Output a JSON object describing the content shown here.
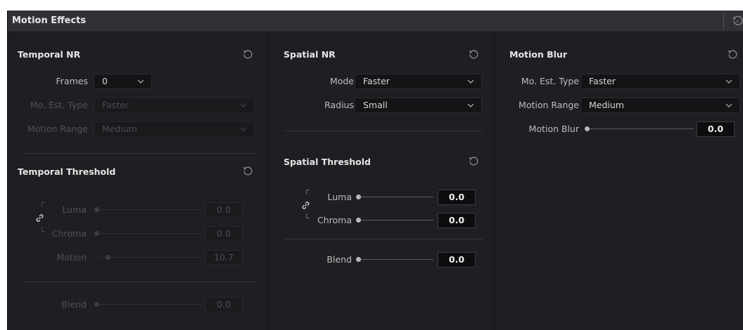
{
  "panel": {
    "title": "Motion Effects",
    "header_reset_icon": "reset-icon"
  },
  "temporal_nr": {
    "title": "Temporal NR",
    "frames_label": "Frames",
    "frames_value": "0",
    "mo_est_type_label": "Mo. Est. Type",
    "mo_est_type_value": "Faster",
    "motion_range_label": "Motion Range",
    "motion_range_value": "Medium",
    "threshold_title": "Temporal Threshold",
    "luma_label": "Luma",
    "luma_value": "0.0",
    "chroma_label": "Chroma",
    "chroma_value": "0.0",
    "motion_label": "Motion",
    "motion_value": "10.7",
    "blend_label": "Blend",
    "blend_value": "0.0"
  },
  "spatial_nr": {
    "title": "Spatial NR",
    "mode_label": "Mode",
    "mode_value": "Faster",
    "radius_label": "Radius",
    "radius_value": "Small",
    "threshold_title": "Spatial Threshold",
    "luma_label": "Luma",
    "luma_value": "0.0",
    "chroma_label": "Chroma",
    "chroma_value": "0.0",
    "blend_label": "Blend",
    "blend_value": "0.0"
  },
  "motion_blur": {
    "title": "Motion Blur",
    "mo_est_type_label": "Mo. Est. Type",
    "mo_est_type_value": "Faster",
    "motion_range_label": "Motion Range",
    "motion_range_value": "Medium",
    "motion_blur_label": "Motion Blur",
    "motion_blur_value": "0.0"
  }
}
